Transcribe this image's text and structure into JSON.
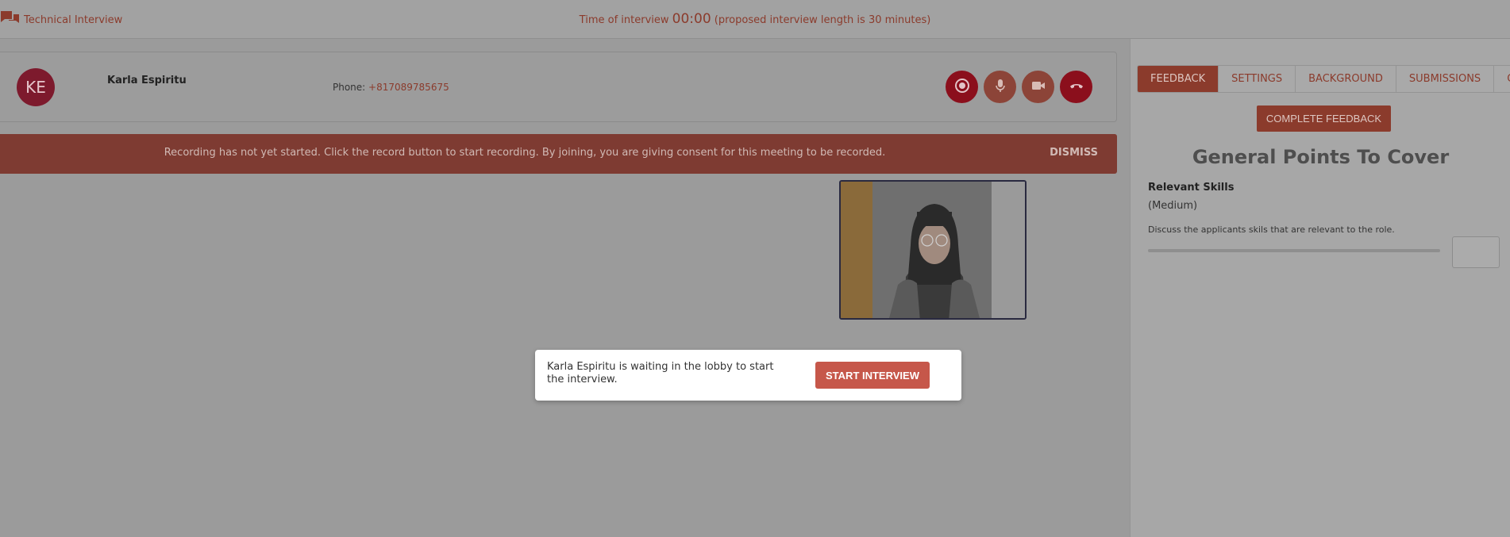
{
  "header": {
    "app_title": "Technical Interview",
    "timer_prefix": "Time of interview",
    "timer_value": "00:00",
    "timer_suffix": "(proposed interview length is 30 minutes)"
  },
  "caller": {
    "initials": "KE",
    "name": "Karla Espiritu",
    "phone_label": "Phone:",
    "phone_number": "+817089785675",
    "controls": [
      "record-icon",
      "microphone-icon",
      "video-camera-icon",
      "hang-up-icon"
    ]
  },
  "recording_banner": {
    "message": "Recording has not yet started. Click the record button to start recording. By joining, you are giving consent for this meeting to be recorded.",
    "dismiss_label": "DISMISS"
  },
  "lobby": {
    "message": "Karla Espiritu is waiting in the lobby to start the interview.",
    "button_label": "START INTERVIEW"
  },
  "sidebar": {
    "tabs": [
      {
        "label": "FEEDBACK",
        "active": true
      },
      {
        "label": "SETTINGS",
        "active": false
      },
      {
        "label": "BACKGROUND",
        "active": false
      },
      {
        "label": "SUBMISSIONS",
        "active": false
      },
      {
        "label": "CH",
        "active": false
      }
    ],
    "complete_feedback_label": "COMPLETE FEEDBACK",
    "section_title": "General Points To Cover",
    "skill": {
      "title": "Relevant Skills",
      "level": "(Medium)",
      "description": "Discuss the applicants skils that are relevant to the role."
    }
  },
  "colors": {
    "accent": "#8b3b2c",
    "primary_button": "#c6574a",
    "record_button": "#8b0f1c"
  }
}
